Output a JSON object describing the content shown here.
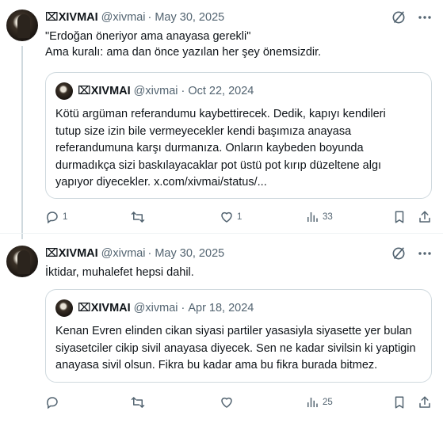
{
  "tweets": [
    {
      "author": {
        "name": "⌧XIVMAI",
        "handle": "@xivmai"
      },
      "separator": "·",
      "date": "May 30, 2025",
      "text_lines": [
        "\"Erdoğan öneriyor ama anayasa gerekli\"",
        "Ama kuralı: ama dan önce yazılan her şey önemsizdir."
      ],
      "quote": {
        "author": {
          "name": "⌧XIVMAI",
          "handle": "@xivmai"
        },
        "separator": "·",
        "date": "Oct 22, 2024",
        "text_lines": [
          "Kötü argüman referandumu kaybettirecek. Dedik, kapıyı kendileri",
          "tutup size izin bile vermeyecekler kendi başımıza anayasa",
          "referandumuna karşı durmanıza. Onların kaybeden boyunda",
          "durmadıkça sizi baskılayacaklar pot üstü pot kırıp düzeltene algı",
          "yapıyor diyecekler. x.com/xivmai/status/..."
        ]
      },
      "stats": {
        "replies": "1",
        "reposts": "",
        "likes": "1",
        "views": "33"
      }
    },
    {
      "author": {
        "name": "⌧XIVMAI",
        "handle": "@xivmai"
      },
      "separator": "·",
      "date": "May 30, 2025",
      "text_lines": [
        "İktidar, muhalefet hepsi dahil."
      ],
      "quote": {
        "author": {
          "name": "⌧XIVMAI",
          "handle": "@xivmai"
        },
        "separator": "·",
        "date": "Apr 18, 2024",
        "text_lines": [
          "Kenan Evren elinden cikan siyasi partiler yasasiyla siyasette yer bulan",
          "siyasetciler cikip sivil anayasa diyecek. Sen ne kadar sivilsin ki yaptigin",
          "anayasa sivil olsun. Fikra bu kadar ama bu fikra burada bitmez."
        ]
      },
      "stats": {
        "replies": "",
        "reposts": "",
        "likes": "",
        "views": "25"
      }
    }
  ],
  "icons": {
    "reply": "reply-icon",
    "repost": "repost-icon",
    "like": "like-icon",
    "views": "views-icon",
    "bookmark": "bookmark-icon",
    "share": "share-icon",
    "grok": "grok-icon",
    "more": "more-icon"
  },
  "colors": {
    "text": "#0f1419",
    "secondary": "#536471",
    "border": "#cfd9de"
  }
}
